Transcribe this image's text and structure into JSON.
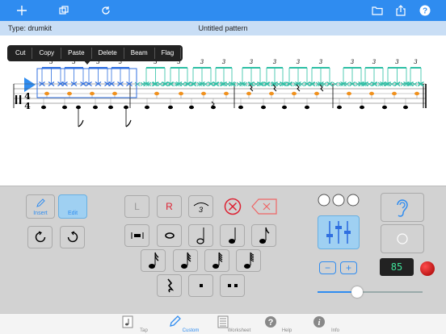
{
  "toolbar": {
    "add_icon": "plus-icon",
    "copy_icon": "duplicate-icon",
    "refresh_icon": "refresh-icon",
    "folder_icon": "folder-icon",
    "share_icon": "share-icon",
    "help_icon": "help-icon"
  },
  "info": {
    "type_label": "Type: drumkit",
    "pattern_title": "Untitled pattern"
  },
  "edit_menu": {
    "items": [
      "Cut",
      "Copy",
      "Paste",
      "Delete",
      "Beam",
      "Flag"
    ]
  },
  "score": {
    "time_signature_top": "4",
    "time_signature_bottom": "4",
    "tuplet_mark": "3",
    "colors": {
      "hihat": "#2bbfa4",
      "selection": "#2f6fe0",
      "snare": "#f0901c",
      "kick": "#000000",
      "play": "#2f8cf0"
    }
  },
  "palette": {
    "insert_label": "Insert",
    "edit_label": "Edit",
    "left_label": "L",
    "right_label": "R",
    "triplet_label": "3",
    "minus_label": "−",
    "plus_label": "+",
    "tempo": "85",
    "slider_value": 0.38
  },
  "tabs": [
    {
      "label": "Tap",
      "icon": "note-page-icon"
    },
    {
      "label": "Custom",
      "icon": "pencil-icon"
    },
    {
      "label": "Worksheet",
      "icon": "worksheet-icon"
    },
    {
      "label": "Help",
      "icon": "help-circle-icon"
    },
    {
      "label": "Info",
      "icon": "info-icon"
    }
  ]
}
